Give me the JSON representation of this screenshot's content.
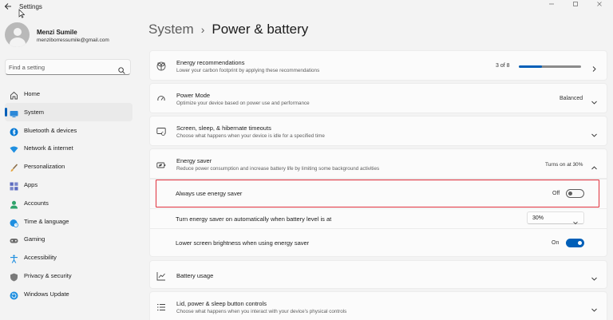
{
  "window": {
    "title": "Settings"
  },
  "user": {
    "name": "Menzi Sumile",
    "email": "menziborressumile@gmail.com"
  },
  "search": {
    "placeholder": "Find a setting"
  },
  "nav": {
    "items": [
      {
        "label": "Home",
        "icon": "home-icon"
      },
      {
        "label": "System",
        "icon": "system-icon",
        "active": true
      },
      {
        "label": "Bluetooth & devices",
        "icon": "bluetooth-icon"
      },
      {
        "label": "Network & internet",
        "icon": "wifi-icon"
      },
      {
        "label": "Personalization",
        "icon": "brush-icon"
      },
      {
        "label": "Apps",
        "icon": "apps-icon"
      },
      {
        "label": "Accounts",
        "icon": "accounts-icon"
      },
      {
        "label": "Time & language",
        "icon": "globe-clock-icon"
      },
      {
        "label": "Gaming",
        "icon": "gamepad-icon"
      },
      {
        "label": "Accessibility",
        "icon": "accessibility-icon"
      },
      {
        "label": "Privacy & security",
        "icon": "shield-icon"
      },
      {
        "label": "Windows Update",
        "icon": "update-icon"
      }
    ]
  },
  "breadcrumb": {
    "parent": "System",
    "separator": "›",
    "current": "Power & battery"
  },
  "cards": {
    "energy_recommendations": {
      "title": "Energy recommendations",
      "description": "Lower your carbon footprint by applying these recommendations",
      "count": "3 of 8",
      "progress": 0.375
    },
    "power_mode": {
      "title": "Power Mode",
      "description": "Optimize your device based on power use and performance",
      "value": "Balanced"
    },
    "screen_sleep": {
      "title": "Screen, sleep, & hibernate timeouts",
      "description": "Choose what happens when your device is idle for a specified time"
    },
    "energy_saver": {
      "title": "Energy saver",
      "description": "Reduce power consumption and increase battery life by limiting some background activities",
      "status": "Turns on at 30%",
      "always_use": {
        "label": "Always use energy saver",
        "state": "Off",
        "on": false
      },
      "auto_on": {
        "label": "Turn energy saver on automatically when battery level is at",
        "value": "30%"
      },
      "lower_brightness": {
        "label": "Lower screen brightness when using energy saver",
        "state": "On",
        "on": true
      }
    },
    "battery_usage": {
      "title": "Battery usage"
    },
    "lid_power": {
      "title": "Lid, power & sleep button controls",
      "description": "Choose what happens when you interact with your device's physical controls"
    }
  },
  "colors": {
    "accent": "#005fb8",
    "highlight_box": "#e0303c"
  }
}
